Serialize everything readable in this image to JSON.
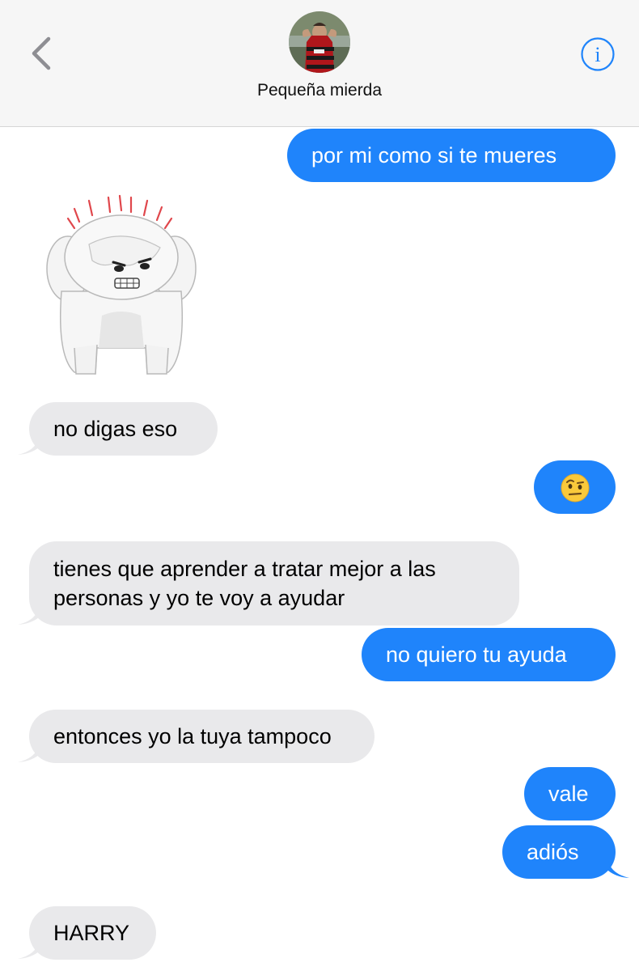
{
  "header": {
    "contact_name": "Pequeña mierda",
    "back_icon": "chevron-left-icon",
    "info_icon": "info-circle-icon",
    "accent_color": "#1f84fb"
  },
  "messages": [
    {
      "from": "me",
      "text": "por mi como si te mueres"
    },
    {
      "from": "them",
      "type": "sticker",
      "sticker": "angry-white-dog-sticker"
    },
    {
      "from": "them",
      "text": "no digas eso"
    },
    {
      "from": "me",
      "text": "🤨"
    },
    {
      "from": "them",
      "text_line1": "tienes que aprender a tratar mejor a las",
      "text_line2": "personas y yo te voy a ayudar"
    },
    {
      "from": "me",
      "text": "no quiero tu ayuda"
    },
    {
      "from": "them",
      "text": "entonces yo la tuya tampoco"
    },
    {
      "from": "me",
      "text": "vale"
    },
    {
      "from": "me",
      "text": "adiós"
    },
    {
      "from": "them",
      "text": "HARRY"
    }
  ],
  "colors": {
    "sent_bubble": "#1f84fb",
    "received_bubble": "#e9e9eb"
  }
}
